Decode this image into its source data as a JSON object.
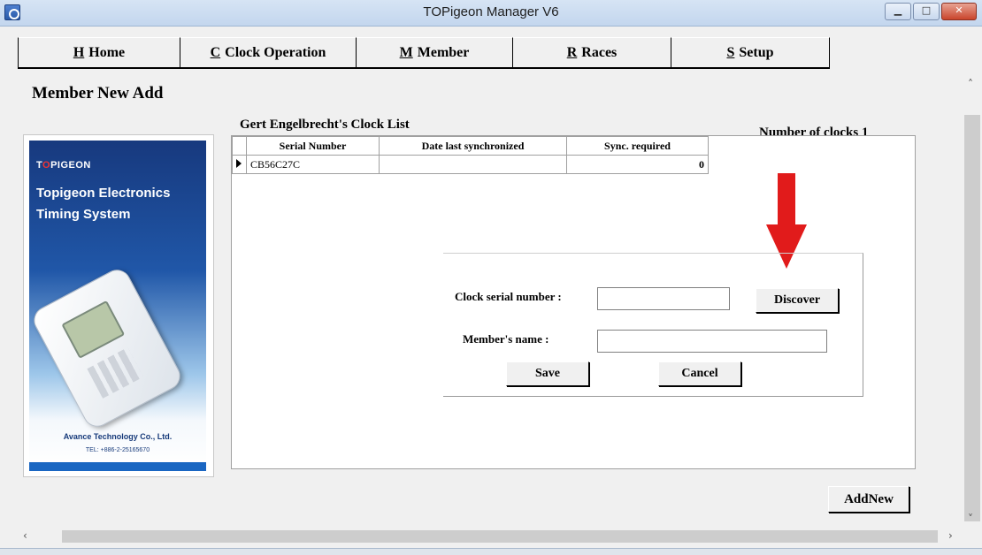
{
  "window": {
    "title": "TOPigeon Manager V6",
    "minimize_glyph": "▁",
    "maximize_glyph": "□",
    "close_glyph": "✕"
  },
  "menu": [
    {
      "hotkey": "H",
      "label": "Home"
    },
    {
      "hotkey": "C",
      "label": "Clock Operation"
    },
    {
      "hotkey": "M",
      "label": "Member"
    },
    {
      "hotkey": "R",
      "label": "Races"
    },
    {
      "hotkey": "S",
      "label": "Setup"
    }
  ],
  "page_title": "Member New Add",
  "banner": {
    "brand": "TOPIGEON",
    "tagline_line1": "Topigeon Electronics",
    "tagline_line2": "Timing System",
    "company": "Avance Technology Co., Ltd.",
    "tel": "TEL: +886-2-25165670"
  },
  "clock_list": {
    "title": "Gert Engelbrecht's Clock List",
    "count_label": "Number of clocks 1",
    "columns": [
      "Serial Number",
      "Date last synchronized",
      "Sync. required"
    ],
    "rows": [
      {
        "serial": "CB56C27C",
        "date": "",
        "sync": "0"
      }
    ]
  },
  "form": {
    "serial_label": "Clock serial number :",
    "serial_value": "",
    "discover_label": "Discover",
    "name_label": "Member's name :",
    "name_value": "",
    "save_label": "Save",
    "cancel_label": "Cancel"
  },
  "addnew_label": "AddNew",
  "colors": {
    "accent_arrow": "#e11b1b",
    "banner_blue": "#1a66c2"
  }
}
